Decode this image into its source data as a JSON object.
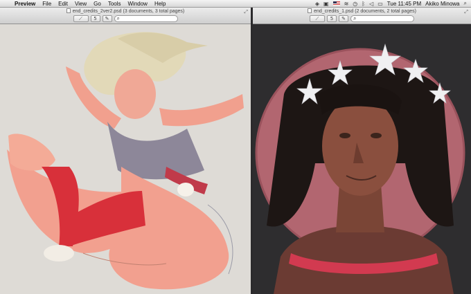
{
  "menubar": {
    "apple_glyph": "",
    "app_name": "Preview",
    "menus": [
      "File",
      "Edit",
      "View",
      "Go",
      "Tools",
      "Window",
      "Help"
    ],
    "clock": "Tue 11:45 PM",
    "user": "Akiko Minowa",
    "status_icons": [
      "dropbox-icon",
      "clipboard-icon",
      "flag-icon",
      "wifi-icon",
      "time-machine-icon",
      "bluetooth-icon",
      "volume-icon",
      "battery-icon"
    ]
  },
  "windows": {
    "left": {
      "title": "end_credits_2ver2.psd (3 documents, 3 total pages)",
      "toolbar": {
        "zoom_label": "5",
        "markup_label": "✎"
      },
      "search_placeholder": ""
    },
    "right": {
      "title": "end_credits_1.psd (2 documents, 2 total pages)",
      "toolbar": {
        "zoom_label": "5",
        "markup_label": "✎"
      },
      "search_placeholder": ""
    }
  },
  "colors": {
    "left_canvas_bg": "#dedbd6",
    "right_canvas_bg": "#2e2d2f",
    "skin": "#f2a08f",
    "muscle": "#d8303a",
    "disc": "#b26670"
  }
}
